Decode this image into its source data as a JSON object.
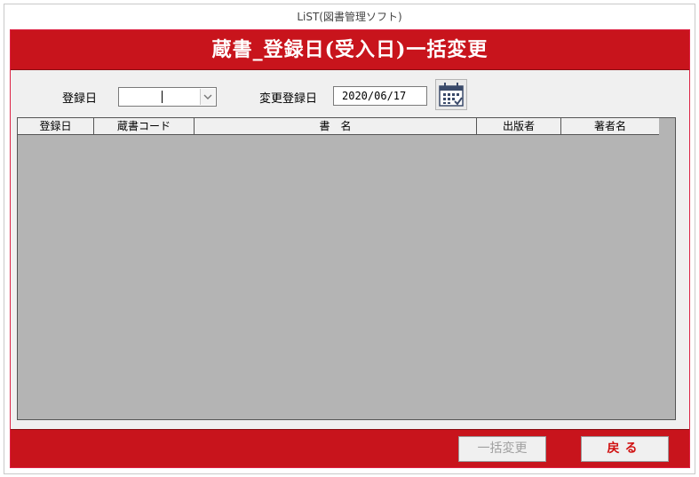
{
  "window": {
    "title": "LiST(図書管理ソフト)"
  },
  "header": {
    "title": "蔵書_登録日(受入日)一括変更"
  },
  "filter": {
    "register_date_label": "登録日",
    "register_date_value": "",
    "change_date_label": "変更登録日",
    "change_date_value": "2020/06/17"
  },
  "grid": {
    "columns": [
      "登録日",
      "蔵書コード",
      "書　名",
      "出版者",
      "著者名"
    ],
    "rows": []
  },
  "footer": {
    "bulk_change_label": "一括変更",
    "back_label": "戻る"
  },
  "colors": {
    "accent": "#c8141c",
    "grid_background": "#b4b4b4"
  },
  "icons": {
    "calendar": "calendar-icon",
    "dropdown": "chevron-down-icon"
  }
}
